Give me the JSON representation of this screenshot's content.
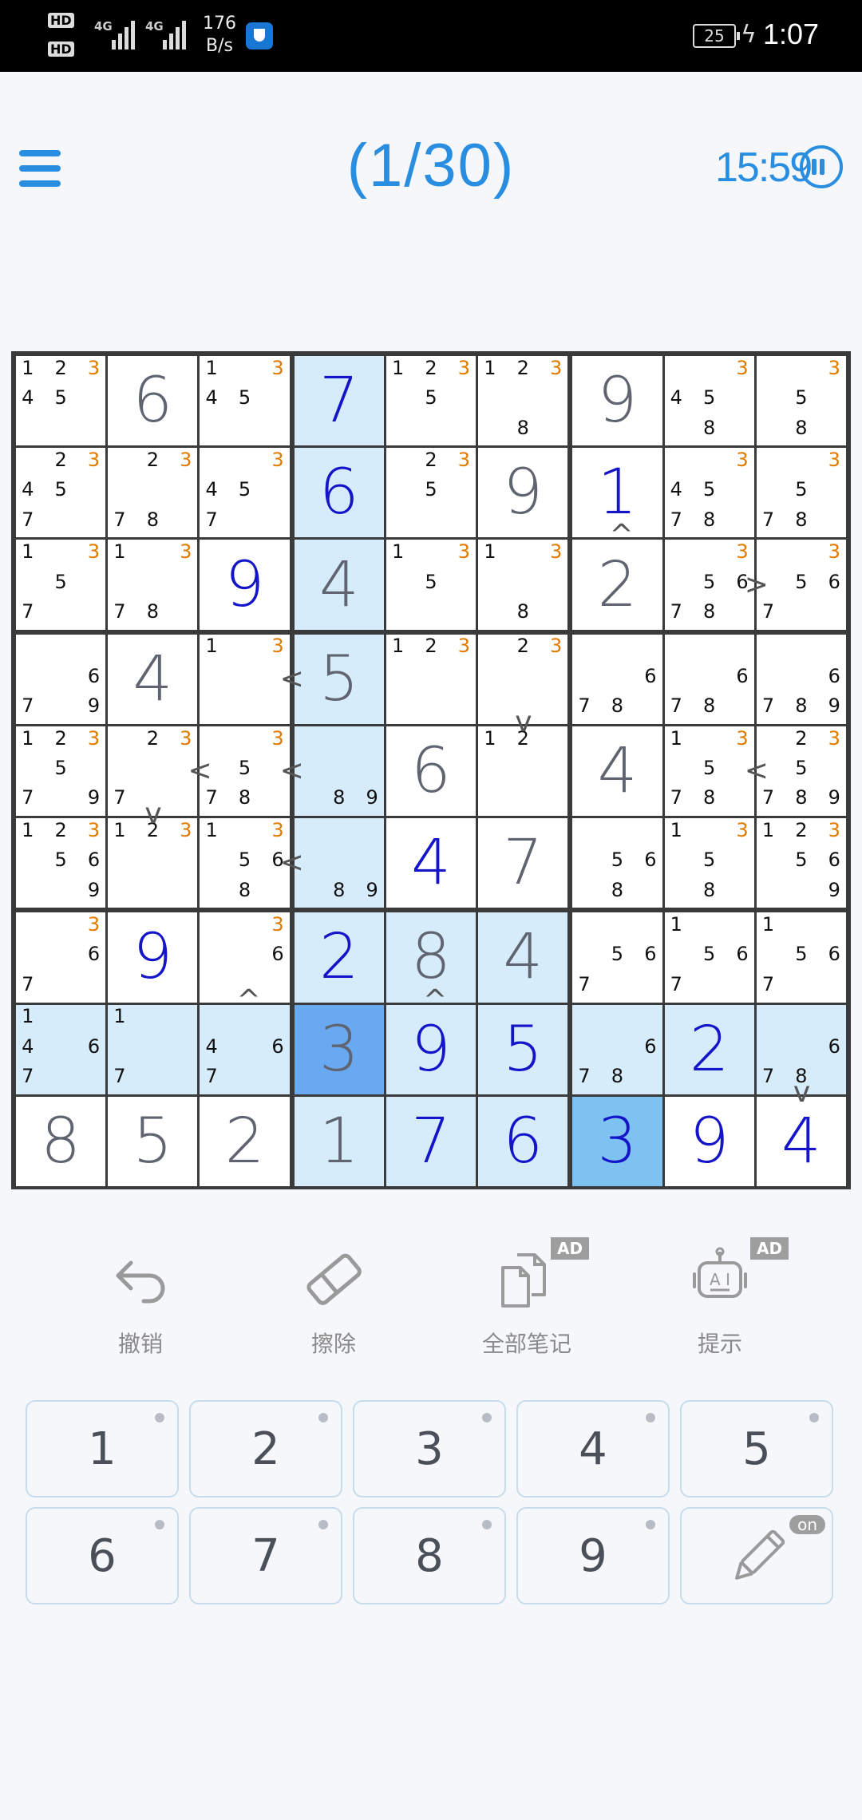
{
  "status_bar": {
    "sim1": "HD",
    "sim2": "HD",
    "net1": "4G",
    "net2": "4G",
    "speed_value": "176",
    "speed_unit": "B/s",
    "battery": "25",
    "time": "1:07"
  },
  "header": {
    "progress": "(1/30)",
    "timer": "15:59"
  },
  "puzzle": {
    "values": [
      [
        0,
        6,
        0,
        7,
        0,
        0,
        9,
        0,
        0
      ],
      [
        0,
        0,
        0,
        6,
        0,
        9,
        1,
        0,
        0
      ],
      [
        0,
        0,
        9,
        4,
        0,
        0,
        2,
        0,
        0
      ],
      [
        0,
        4,
        0,
        5,
        0,
        0,
        0,
        0,
        0
      ],
      [
        0,
        0,
        0,
        0,
        6,
        0,
        4,
        0,
        0
      ],
      [
        0,
        0,
        0,
        0,
        4,
        7,
        0,
        0,
        0
      ],
      [
        0,
        9,
        0,
        2,
        8,
        4,
        0,
        0,
        0
      ],
      [
        0,
        0,
        0,
        3,
        9,
        5,
        0,
        2,
        0
      ],
      [
        8,
        5,
        2,
        1,
        7,
        6,
        3,
        9,
        4
      ]
    ],
    "given": [
      [
        0,
        1,
        0,
        0,
        0,
        0,
        1,
        0,
        0
      ],
      [
        0,
        0,
        0,
        0,
        0,
        1,
        0,
        0,
        0
      ],
      [
        0,
        0,
        0,
        1,
        0,
        0,
        1,
        0,
        0
      ],
      [
        0,
        1,
        0,
        1,
        0,
        0,
        0,
        0,
        0
      ],
      [
        0,
        0,
        0,
        0,
        1,
        0,
        1,
        0,
        0
      ],
      [
        0,
        0,
        0,
        0,
        0,
        1,
        0,
        0,
        0
      ],
      [
        0,
        0,
        0,
        0,
        1,
        1,
        0,
        0,
        0
      ],
      [
        0,
        0,
        0,
        1,
        0,
        0,
        0,
        0,
        0
      ],
      [
        1,
        1,
        1,
        1,
        0,
        0,
        0,
        0,
        0
      ]
    ],
    "notes": [
      [
        "12345",
        "",
        "1345",
        "",
        "1235",
        "1238",
        "",
        "3458",
        "358"
      ],
      [
        "23457",
        "2378",
        "3457",
        "",
        "235",
        "",
        "",
        "34578",
        "3578"
      ],
      [
        "1357",
        "1378",
        "",
        "",
        "135",
        "138",
        "",
        "35678",
        "3567"
      ],
      [
        "679",
        "",
        "13",
        "",
        "123",
        "23",
        "678",
        "678",
        "6789"
      ],
      [
        "123579",
        "237",
        "3578",
        "89",
        "",
        "12",
        "",
        "13578",
        "235789"
      ],
      [
        "123569",
        "123",
        "13568",
        "89",
        "",
        "",
        "568",
        "1358",
        "123569"
      ],
      [
        "367",
        "",
        "36",
        "",
        "",
        "",
        "567",
        "1567",
        "1567"
      ],
      [
        "1467",
        "17",
        "467",
        "",
        "",
        "",
        "678",
        "",
        "678"
      ],
      [
        "",
        "",
        "",
        "",
        "",
        "",
        "",
        "",
        ""
      ]
    ],
    "highlight": [
      [
        0,
        0,
        0,
        1,
        0,
        0,
        0,
        0,
        0
      ],
      [
        0,
        0,
        0,
        1,
        0,
        0,
        0,
        0,
        0
      ],
      [
        0,
        0,
        0,
        1,
        0,
        0,
        0,
        0,
        0
      ],
      [
        0,
        0,
        0,
        1,
        0,
        0,
        0,
        0,
        0
      ],
      [
        0,
        0,
        0,
        1,
        0,
        0,
        0,
        0,
        0
      ],
      [
        0,
        0,
        0,
        1,
        0,
        0,
        0,
        0,
        0
      ],
      [
        0,
        0,
        0,
        1,
        1,
        1,
        0,
        0,
        0
      ],
      [
        1,
        1,
        1,
        2,
        1,
        1,
        1,
        1,
        1
      ],
      [
        0,
        0,
        0,
        1,
        1,
        1,
        3,
        0,
        0
      ]
    ],
    "highlight_note_digit": "3",
    "comparisons": [
      {
        "symbol": "^",
        "row": 1,
        "col": 6,
        "side": "bottom"
      },
      {
        "symbol": ">",
        "row": 2,
        "col": 7,
        "side": "right"
      },
      {
        "symbol": "<",
        "row": 3,
        "col": 2,
        "side": "right"
      },
      {
        "symbol": "v",
        "row": 3,
        "col": 5,
        "side": "bottom"
      },
      {
        "symbol": "<",
        "row": 4,
        "col": 1,
        "side": "right"
      },
      {
        "symbol": "<",
        "row": 4,
        "col": 2,
        "side": "right"
      },
      {
        "symbol": "<",
        "row": 4,
        "col": 7,
        "side": "right"
      },
      {
        "symbol": "v",
        "row": 4,
        "col": 1,
        "side": "bottom"
      },
      {
        "symbol": "<",
        "row": 5,
        "col": 2,
        "side": "right"
      },
      {
        "symbol": "^",
        "row": 6,
        "col": 2,
        "side": "bottom"
      },
      {
        "symbol": "^",
        "row": 6,
        "col": 4,
        "side": "bottom"
      },
      {
        "symbol": "v",
        "row": 7,
        "col": 8,
        "side": "bottom"
      }
    ]
  },
  "toolbar": {
    "undo": "撤销",
    "erase": "擦除",
    "all_notes": "全部笔记",
    "hint": "提示",
    "ad_badge": "AD",
    "robot_label": "A I"
  },
  "keypad": {
    "digits": [
      "1",
      "2",
      "3",
      "4",
      "5",
      "6",
      "7",
      "8",
      "9"
    ],
    "pencil_state": "on"
  },
  "colors": {
    "accent": "#2a8ee0",
    "user_digit": "#1414c8",
    "given_digit": "#5f6470",
    "highlight_cell": "#d6ecfb",
    "selected_cell": "#68a9f2",
    "note_highlight": "#e07b00"
  }
}
